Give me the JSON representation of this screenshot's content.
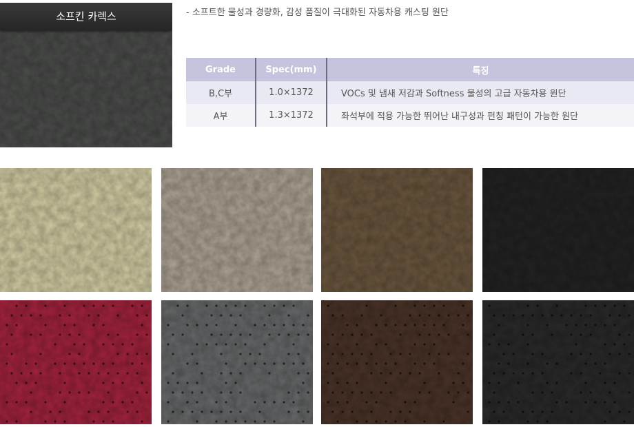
{
  "hero": {
    "title": "소프킨 카렉스",
    "color": "#4b4d4b"
  },
  "description": "- 소프트한 물성과 경량화, 감성 품질이 극대화된 자동차용 캐스팅 원단",
  "spec_table": {
    "headers": [
      "Grade",
      "Spec(mm)",
      "특징"
    ],
    "rows": [
      [
        "B,C부",
        "1.0×1372",
        "VOCs 및 냄새 저감과 Softness 물성의 고급 자동차용 원단"
      ],
      [
        "A부",
        "1.3×1372",
        "좌석부에 적용 가능한 뛰어난 내구성과 펀칭 패턴이 가능한 원단"
      ]
    ],
    "header_color": "#c5c3dd",
    "divider_color": "#6b6b84"
  },
  "swatches": [
    {
      "color": "#d2cda3",
      "perforated": false
    },
    {
      "color": "#aca393",
      "perforated": false
    },
    {
      "color": "#6a563e",
      "perforated": false
    },
    {
      "color": "#232323",
      "perforated": false
    },
    {
      "color": "#a2233e",
      "perforated": true
    },
    {
      "color": "#67696a",
      "perforated": true
    },
    {
      "color": "#4a3328",
      "perforated": true
    },
    {
      "color": "#2a2a2a",
      "perforated": true
    }
  ]
}
